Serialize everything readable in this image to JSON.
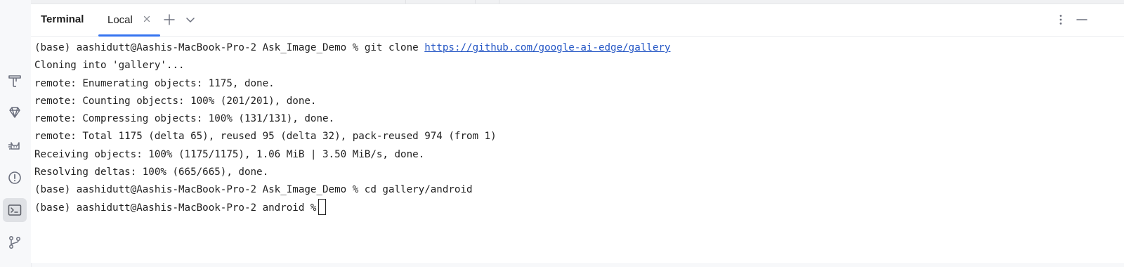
{
  "panel": {
    "title": "Terminal",
    "tab": {
      "label": "Local"
    }
  },
  "colors": {
    "accent": "#3574f0",
    "link": "#2456c5",
    "text": "#1f1f1f",
    "icon": "#6c707e"
  },
  "strip_icons": [
    "build-icon",
    "gem-icon",
    "cat-icon",
    "problems-icon",
    "terminal-icon",
    "git-branch-icon"
  ],
  "terminal": {
    "lines": [
      {
        "prompt_user": "(base) aashidutt@Aashis-MacBook-Pro-2",
        "prompt_dir": "Ask_Image_Demo",
        "command": "git clone",
        "link": "https://github.com/google-ai-edge/gallery"
      },
      {
        "text": "Cloning into 'gallery'..."
      },
      {
        "text": "remote: Enumerating objects: 1175, done."
      },
      {
        "text": "remote: Counting objects: 100% (201/201), done."
      },
      {
        "text": "remote: Compressing objects: 100% (131/131), done."
      },
      {
        "text": "remote: Total 1175 (delta 65), reused 95 (delta 32), pack-reused 974 (from 1)"
      },
      {
        "text": "Receiving objects: 100% (1175/1175), 1.06 MiB | 3.50 MiB/s, done."
      },
      {
        "text": "Resolving deltas: 100% (665/665), done."
      },
      {
        "text": "(base) aashidutt@Aashis-MacBook-Pro-2 Ask_Image_Demo % cd gallery/android"
      },
      {
        "text": "(base) aashidutt@Aashis-MacBook-Pro-2 android %"
      }
    ]
  }
}
